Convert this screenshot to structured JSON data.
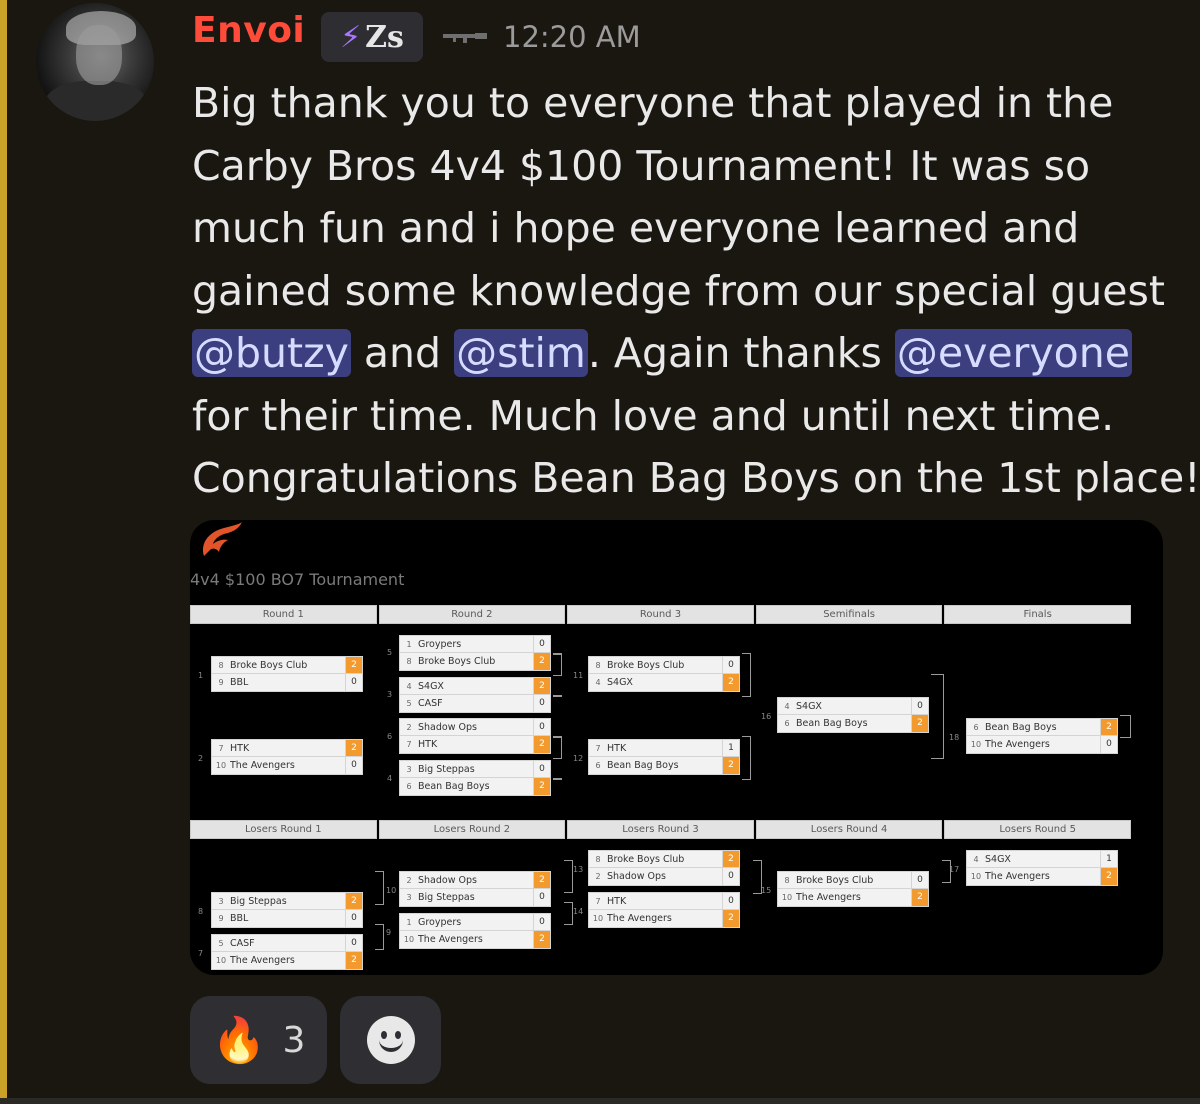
{
  "message": {
    "author": "Envoi",
    "tag_text": "Zs",
    "icons": {
      "tag": "lightning-bolt-icon",
      "decoration": "rifle-icon",
      "reaction_add": "smile-icon",
      "embed_logo": "flame-logo"
    },
    "timestamp": "12:20 AM",
    "lines": [
      {
        "text": "Big thank you to everyone that played in the"
      },
      {
        "text": "Carby Bros 4v4 $100 Tournament! It was so"
      },
      {
        "text": "much fun and i hope everyone learned and"
      },
      {
        "text": "gained some knowledge from our special guest"
      }
    ],
    "line5": {
      "mention1": "@butzy",
      "mid": " and ",
      "mention2": "@stim",
      "after": ". Again thanks ",
      "mention3": "@everyone"
    },
    "line6": "for their time. Much love and until next time.",
    "line7": "Congratulations Bean Bag Boys on the 1st place!"
  },
  "colors": {
    "username": "#ff4b3a",
    "mention_bg": "#3b3f80",
    "accent_bar": "#c9a227",
    "winner_score": "#f29a2e"
  },
  "embed": {
    "title": "4v4 $100 BO7 Tournament",
    "winners_rounds": [
      "Round 1",
      "Round 2",
      "Round 3",
      "Semifinals",
      "Finals"
    ],
    "losers_rounds": [
      "Losers Round 1",
      "Losers Round 2",
      "Losers Round 3",
      "Losers Round 4",
      "Losers Round 5"
    ],
    "winners_matches": [
      {
        "num": "1",
        "teams": [
          {
            "seed": "8",
            "name": "Broke Boys Club",
            "score": "2",
            "win": true
          },
          {
            "seed": "9",
            "name": "BBL",
            "score": "0",
            "win": false
          }
        ]
      },
      {
        "num": "2",
        "teams": [
          {
            "seed": "7",
            "name": "HTK",
            "score": "2",
            "win": true
          },
          {
            "seed": "10",
            "name": "The Avengers",
            "score": "0",
            "win": false
          }
        ]
      },
      {
        "num": "",
        "teams": [
          {
            "seed": "1",
            "name": "Groypers",
            "score": "0",
            "win": false
          },
          {
            "seed": "8",
            "name": "Broke Boys Club",
            "score": "2",
            "win": true
          }
        ]
      },
      {
        "num": "",
        "teams": [
          {
            "seed": "4",
            "name": "S4GX",
            "score": "2",
            "win": true
          },
          {
            "seed": "5",
            "name": "CASF",
            "score": "0",
            "win": false
          }
        ]
      },
      {
        "num": "",
        "teams": [
          {
            "seed": "2",
            "name": "Shadow Ops",
            "score": "0",
            "win": false
          },
          {
            "seed": "7",
            "name": "HTK",
            "score": "2",
            "win": true
          }
        ]
      },
      {
        "num": "",
        "teams": [
          {
            "seed": "3",
            "name": "Big Steppas",
            "score": "0",
            "win": false
          },
          {
            "seed": "6",
            "name": "Bean Bag Boys",
            "score": "2",
            "win": true
          }
        ]
      },
      {
        "num": "11",
        "teams": [
          {
            "seed": "8",
            "name": "Broke Boys Club",
            "score": "0",
            "win": false
          },
          {
            "seed": "4",
            "name": "S4GX",
            "score": "2",
            "win": true
          }
        ]
      },
      {
        "num": "12",
        "teams": [
          {
            "seed": "7",
            "name": "HTK",
            "score": "1",
            "win": false
          },
          {
            "seed": "6",
            "name": "Bean Bag Boys",
            "score": "2",
            "win": true
          }
        ]
      },
      {
        "num": "16",
        "teams": [
          {
            "seed": "4",
            "name": "S4GX",
            "score": "0",
            "win": false
          },
          {
            "seed": "6",
            "name": "Bean Bag Boys",
            "score": "2",
            "win": true
          }
        ]
      },
      {
        "num": "18",
        "teams": [
          {
            "seed": "6",
            "name": "Bean Bag Boys",
            "score": "2",
            "win": true
          },
          {
            "seed": "10",
            "name": "The Avengers",
            "score": "0",
            "win": false
          }
        ]
      }
    ],
    "winners_labels": [
      "5",
      "3",
      "6",
      "4"
    ],
    "losers_matches": [
      {
        "num": "8",
        "teams": [
          {
            "seed": "3",
            "name": "Big Steppas",
            "score": "2",
            "win": true
          },
          {
            "seed": "9",
            "name": "BBL",
            "score": "0",
            "win": false
          }
        ]
      },
      {
        "num": "7",
        "teams": [
          {
            "seed": "5",
            "name": "CASF",
            "score": "0",
            "win": false
          },
          {
            "seed": "10",
            "name": "The Avengers",
            "score": "2",
            "win": true
          }
        ]
      },
      {
        "num": "10",
        "teams": [
          {
            "seed": "2",
            "name": "Shadow Ops",
            "score": "2",
            "win": true
          },
          {
            "seed": "3",
            "name": "Big Steppas",
            "score": "0",
            "win": false
          }
        ]
      },
      {
        "num": "9",
        "teams": [
          {
            "seed": "1",
            "name": "Groypers",
            "score": "0",
            "win": false
          },
          {
            "seed": "10",
            "name": "The Avengers",
            "score": "2",
            "win": true
          }
        ]
      },
      {
        "num": "13",
        "teams": [
          {
            "seed": "8",
            "name": "Broke Boys Club",
            "score": "2",
            "win": true
          },
          {
            "seed": "2",
            "name": "Shadow Ops",
            "score": "0",
            "win": false
          }
        ]
      },
      {
        "num": "14",
        "teams": [
          {
            "seed": "7",
            "name": "HTK",
            "score": "0",
            "win": false
          },
          {
            "seed": "10",
            "name": "The Avengers",
            "score": "2",
            "win": true
          }
        ]
      },
      {
        "num": "15",
        "teams": [
          {
            "seed": "8",
            "name": "Broke Boys Club",
            "score": "0",
            "win": false
          },
          {
            "seed": "10",
            "name": "The Avengers",
            "score": "2",
            "win": true
          }
        ]
      },
      {
        "num": "17",
        "teams": [
          {
            "seed": "4",
            "name": "S4GX",
            "score": "1",
            "win": false
          },
          {
            "seed": "10",
            "name": "The Avengers",
            "score": "2",
            "win": true
          }
        ]
      }
    ]
  },
  "reactions": [
    {
      "emoji": "🔥",
      "count": "3"
    }
  ]
}
